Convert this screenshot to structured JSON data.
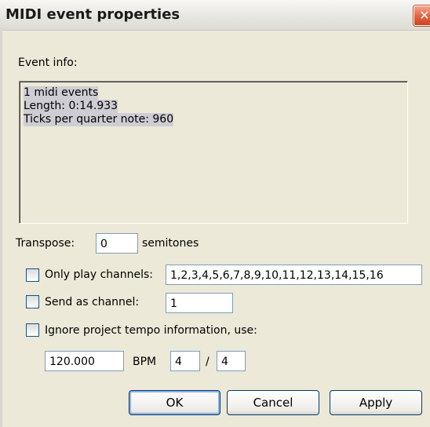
{
  "window": {
    "title": "MIDI event properties",
    "close_glyph": "✕"
  },
  "event_info": {
    "label": "Event info:",
    "lines": [
      "1 midi events",
      "Length: 0:14.933",
      "Ticks per quarter note: 960"
    ]
  },
  "transpose": {
    "label": "Transpose:",
    "value": "0",
    "unit": "semitones"
  },
  "only_play_channels": {
    "label": "Only play channels:",
    "checked": false,
    "value": "1,2,3,4,5,6,7,8,9,10,11,12,13,14,15,16"
  },
  "send_as_channel": {
    "label": "Send as channel:",
    "checked": false,
    "value": "1"
  },
  "ignore_tempo": {
    "label": "Ignore project tempo information, use:",
    "checked": false,
    "bpm_value": "120.000",
    "bpm_label": "BPM",
    "numerator": "4",
    "slash": "/",
    "denominator": "4"
  },
  "buttons": {
    "ok": "OK",
    "cancel": "Cancel",
    "apply": "Apply"
  },
  "colors": {
    "face": "#ece9d8",
    "title_gradient_end": "#dcdbd3",
    "close": "#e2623f",
    "field_border": "#7f9db9",
    "selection": "#cfcdd4"
  },
  "icons": {
    "close": "close-icon"
  }
}
